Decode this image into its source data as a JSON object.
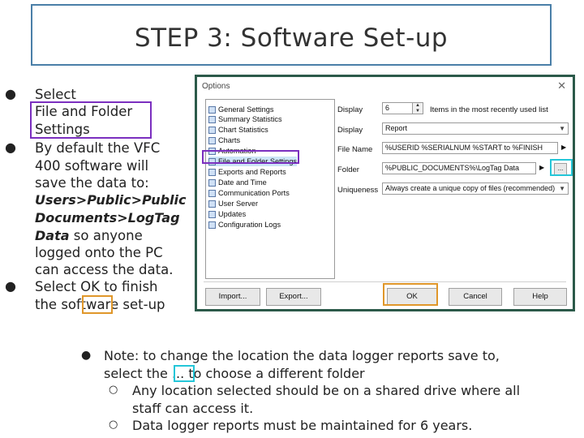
{
  "title": "STEP 3: Software Set-up",
  "left_bullets": {
    "b1_lines": [
      "Select",
      "File and Folder",
      "Settings"
    ],
    "b2_lines": [
      "By default the VFC",
      "400 software will",
      "save the data to:"
    ],
    "b2_path_1": "Users>Public>Public",
    "b2_path_2": "Documents>LogTag",
    "b2_path_3": "Data",
    "b2_path_3_rest": " so anyone",
    "b2_rest_lines": [
      "logged onto the PC",
      "can access the data."
    ],
    "b3_lines": [
      "Select OK to finish",
      "the  software set-up"
    ]
  },
  "dialog": {
    "title": "Options",
    "close": "✕",
    "tree_items": [
      "General Settings",
      "Summary Statistics",
      "Chart Statistics",
      "Charts",
      "Automation",
      "File and Folder Settings",
      "Exports and Reports",
      "Date and Time",
      "Communication Ports",
      "User Server",
      "Updates",
      "Configuration Logs"
    ],
    "display_label": "Display",
    "display_value": "6",
    "display_suffix": "Items in the most recently used list",
    "display2_label": "Display",
    "display2_value": "Report",
    "filename_label": "File Name",
    "filename_value": "%USERID %SERIALNUM %START to %FINISH",
    "folder_label": "Folder",
    "folder_value": "%PUBLIC_DOCUMENTS%\\LogTag Data",
    "browse": "...",
    "uniqueness_label": "Uniqueness",
    "uniqueness_value": "Always create a unique copy of files (recommended)",
    "import_btn": "Import...",
    "export_btn": "Export...",
    "ok_btn": "OK",
    "cancel_btn": "Cancel",
    "help_btn": "Help"
  },
  "notes": {
    "main_1": "Note: to change the location the data logger reports save to,",
    "main_2a": "select the ",
    "main_2b": "...",
    "main_2c": " to choose a different folder",
    "sub_1a": "Any location selected should be on a shared drive where all",
    "sub_1b": "staff can access it.",
    "sub_2": "Data logger reports must be maintained for 6 years."
  },
  "colors": {
    "purple": "#7b2fbf",
    "orange": "#e0972a",
    "cyan": "#24c6d8",
    "title_border": "#4a7fa8"
  }
}
